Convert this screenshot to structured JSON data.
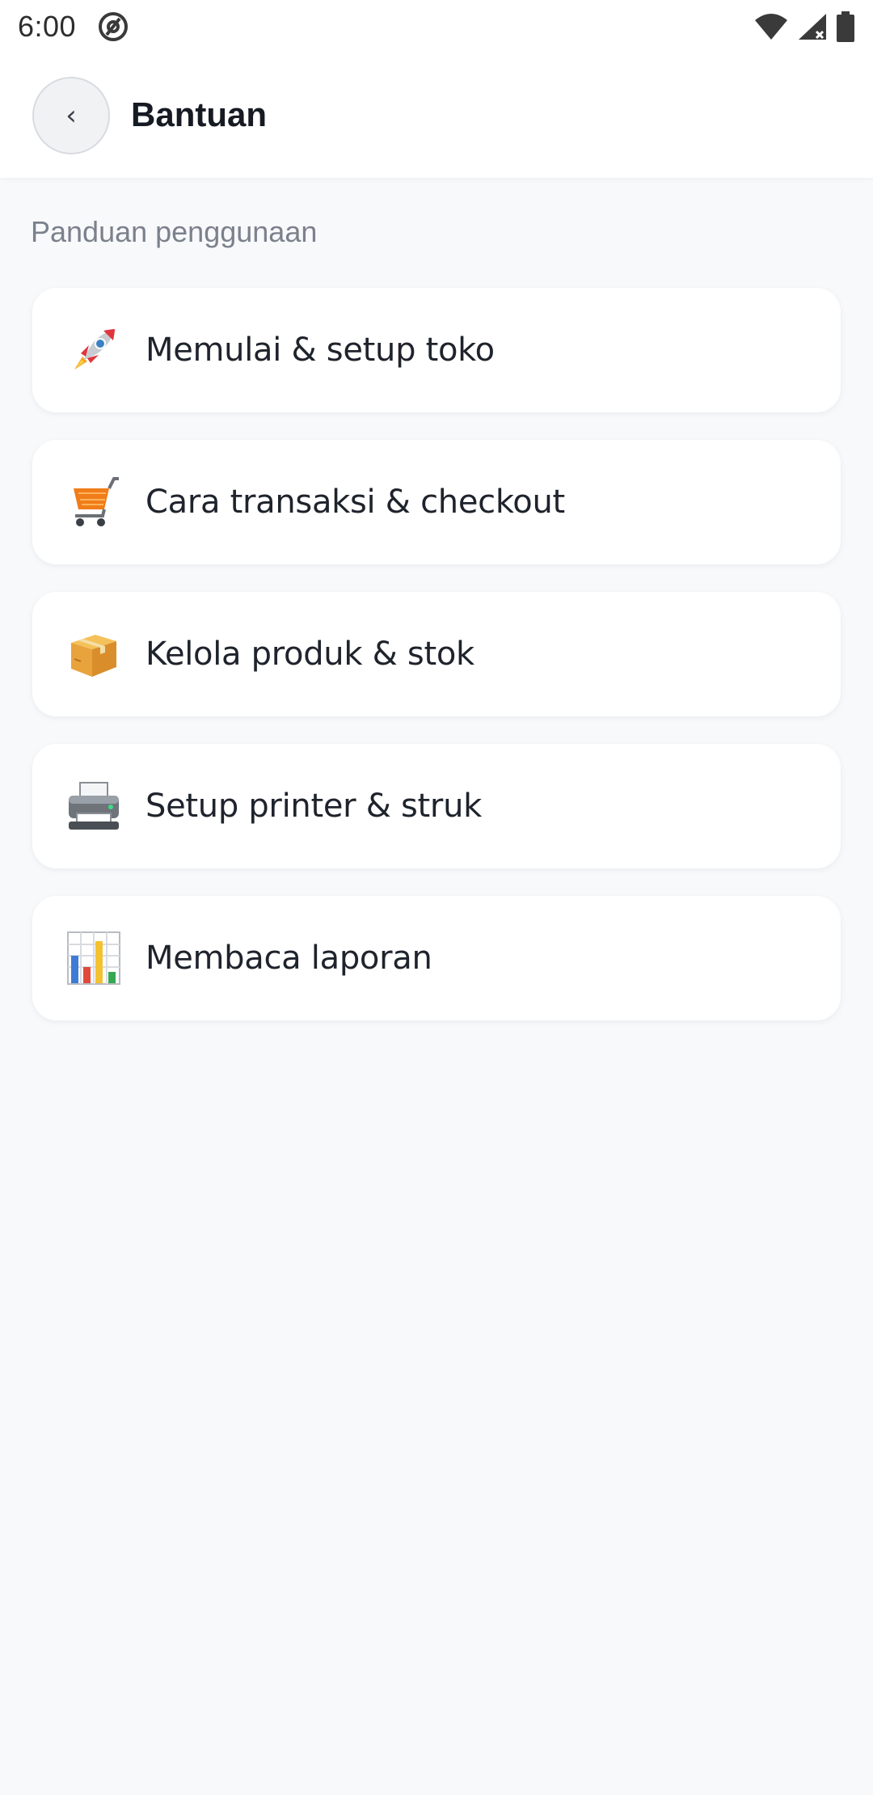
{
  "status_bar": {
    "time": "6:00",
    "icons": [
      "at-sign-icon",
      "wifi-icon",
      "cellular-signal-icon",
      "battery-icon"
    ]
  },
  "header": {
    "back_icon": "‹",
    "title": "Bantuan"
  },
  "section": {
    "label": "Panduan penggunaan"
  },
  "guides": [
    {
      "icon": "rocket-icon",
      "label": "Memulai & setup toko"
    },
    {
      "icon": "shopping-cart-icon",
      "label": "Cara transaksi & checkout"
    },
    {
      "icon": "package-icon",
      "label": "Kelola produk & stok"
    },
    {
      "icon": "printer-icon",
      "label": "Setup printer & struk"
    },
    {
      "icon": "bar-chart-icon",
      "label": "Membaca laporan"
    }
  ],
  "colors": {
    "background": "#f8f9fb",
    "card": "#ffffff",
    "title": "#161a22",
    "section_label": "#7b818c"
  }
}
